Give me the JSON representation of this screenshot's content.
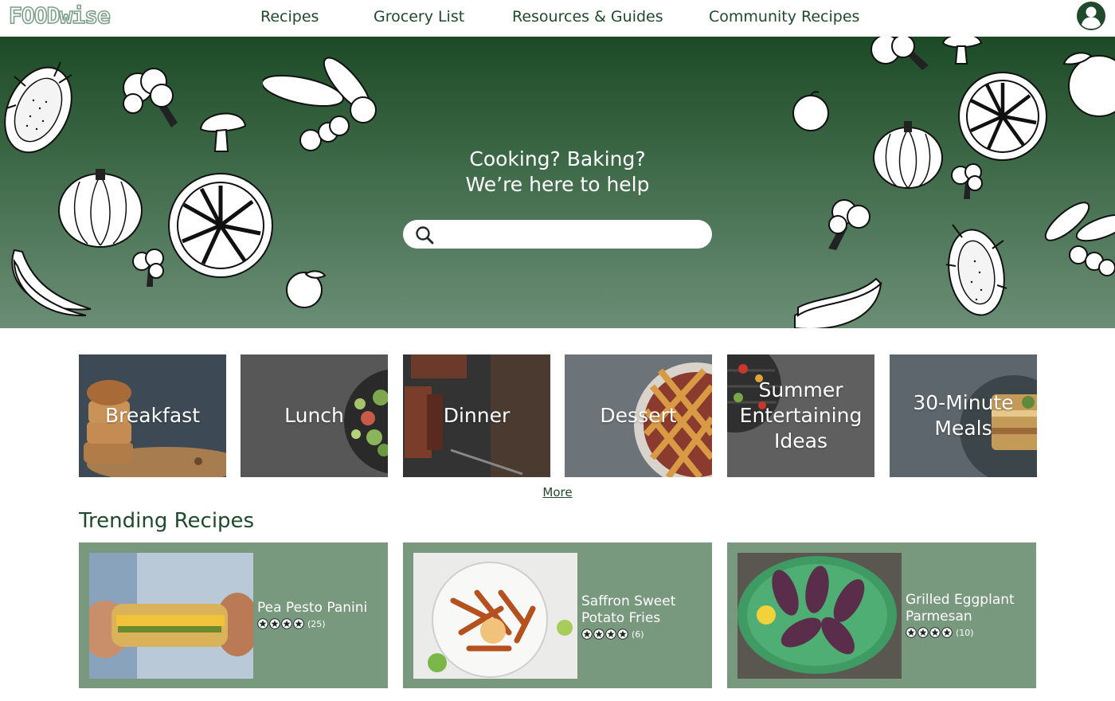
{
  "brand": {
    "logo_text": "FOODwise"
  },
  "nav": {
    "items": [
      {
        "label": "Recipes"
      },
      {
        "label": "Grocery List"
      },
      {
        "label": "Resources & Guides"
      },
      {
        "label": "Community Recipes"
      }
    ],
    "account_icon": "user-circle-icon"
  },
  "hero": {
    "line1": "Cooking? Baking?",
    "line2": "We’re here to help",
    "search_icon": "search-icon",
    "search_value": ""
  },
  "categories": [
    {
      "label": "Breakfast"
    },
    {
      "label": "Lunch"
    },
    {
      "label": "Dinner"
    },
    {
      "label": "Dessert"
    },
    {
      "label": "Summer Entertaining Ideas"
    },
    {
      "label": "30-Minute Meals"
    }
  ],
  "more_link": "More",
  "trending": {
    "title": "Trending Recipes",
    "recipes": [
      {
        "name": "Pea Pesto Panini",
        "stars": 4,
        "count": "(25)"
      },
      {
        "name": "Saffron Sweet Potato Fries",
        "stars": 4,
        "count": "(6)"
      },
      {
        "name": "Grilled Eggplant Parmesan",
        "stars": 4,
        "count": "(10)"
      }
    ]
  },
  "colors": {
    "brand_green": "#1f4a2b",
    "hero_top": "#1c4a26",
    "hero_bottom": "#6b8e76",
    "card_bg": "#78997e"
  }
}
